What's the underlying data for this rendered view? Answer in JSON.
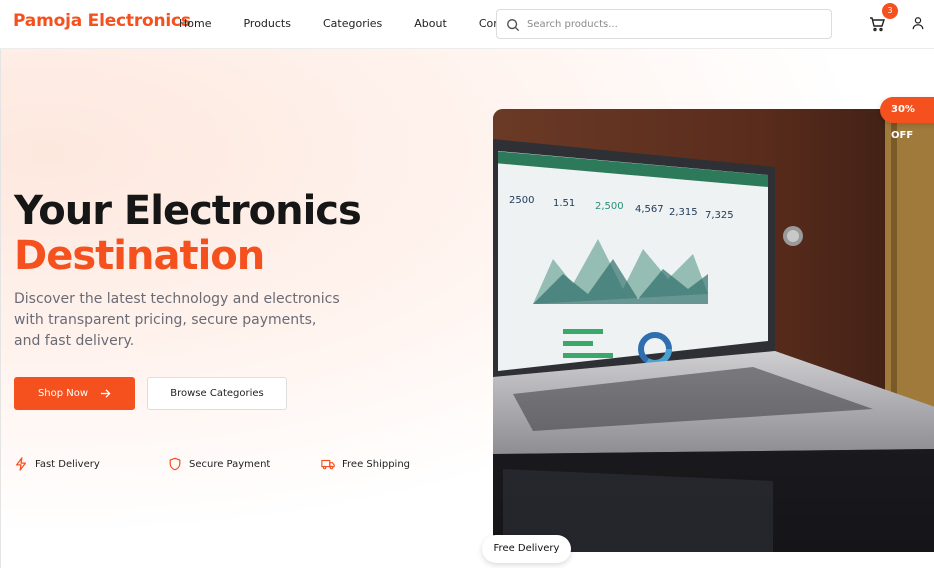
{
  "header": {
    "brand": "Pamoja Electronics",
    "nav": [
      "Home",
      "Products",
      "Categories",
      "About",
      "Contact"
    ],
    "search_placeholder": "Search products...",
    "cart_count": "3"
  },
  "hero": {
    "title_line1": "Your Electronics",
    "title_line2": "Destination",
    "description": "Discover the latest technology and electronics with transparent pricing, secure payments, and fast delivery.",
    "shop_button": "Shop Now",
    "browse_button": "Browse Categories",
    "features": [
      "Fast Delivery",
      "Secure Payment",
      "Free Shipping"
    ],
    "discount_badge": "30% OFF",
    "delivery_badge": "Free Delivery"
  },
  "laptop_screen": {
    "stats": [
      "2500",
      "1.51",
      "2,500",
      "4,567",
      "2,315",
      "7,325"
    ]
  },
  "colors": {
    "accent": "#f4511e",
    "text_dark": "#161616",
    "text_muted": "#6b6b75"
  }
}
